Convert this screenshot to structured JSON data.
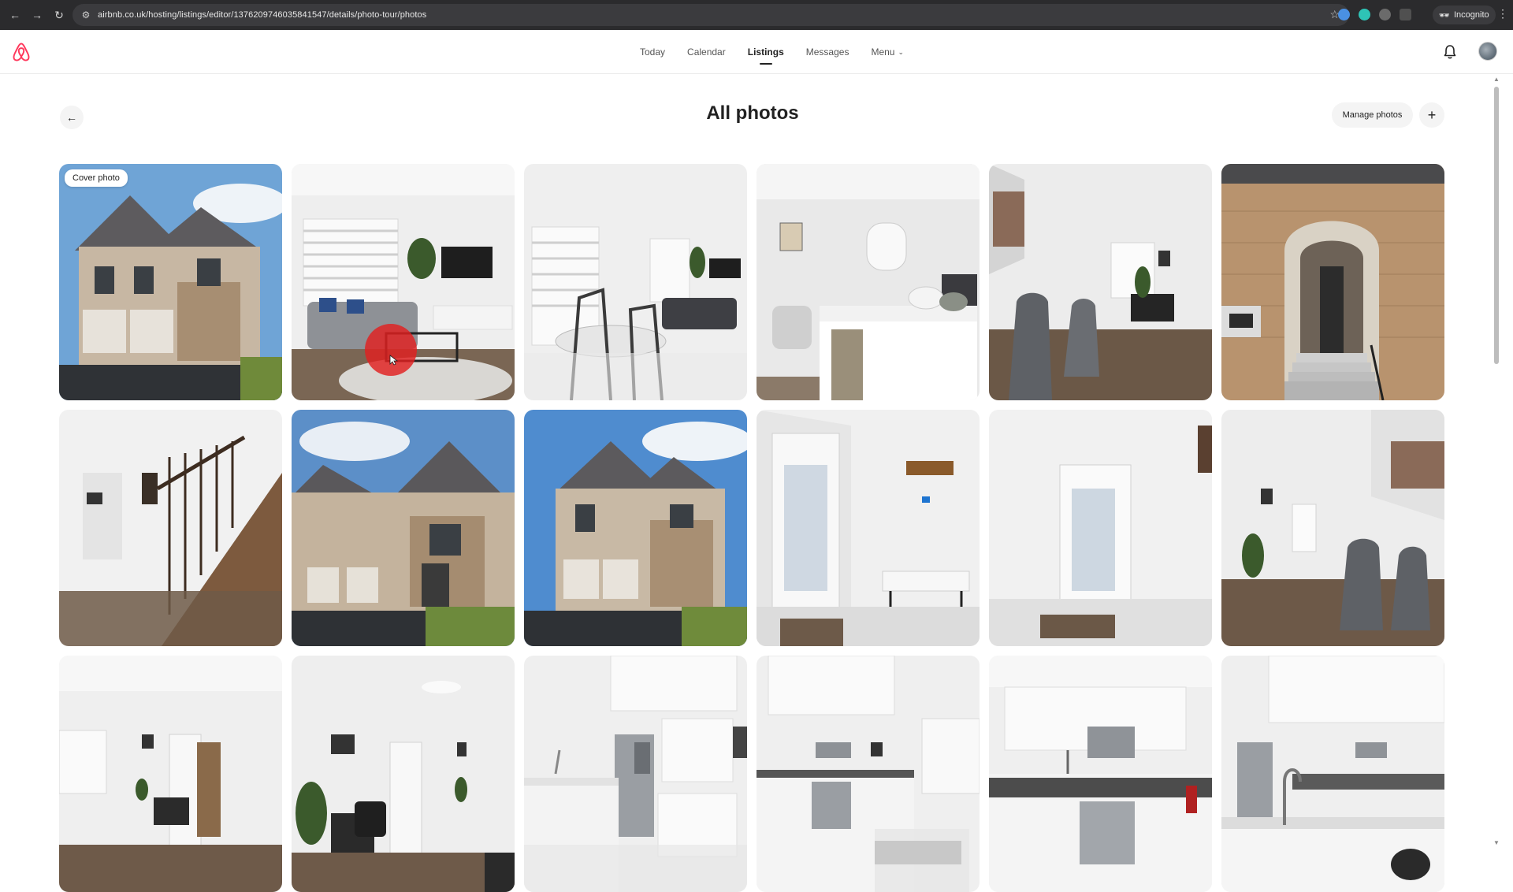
{
  "browser": {
    "url": "airbnb.co.uk/hosting/listings/editor/1376209746035841547/details/photo-tour/photos",
    "incognito_label": "Incognito",
    "icons": [
      "back-arrow-icon",
      "forward-arrow-icon",
      "reload-icon",
      "site-info-icon",
      "bookmark-star-icon",
      "extensions-icon",
      "kebab-menu-icon"
    ]
  },
  "header": {
    "nav": [
      {
        "label": "Today"
      },
      {
        "label": "Calendar"
      },
      {
        "label": "Listings"
      },
      {
        "label": "Messages"
      },
      {
        "label": "Menu"
      }
    ],
    "active_tab": "Listings"
  },
  "page": {
    "title": "All photos",
    "manage_label": "Manage photos",
    "add_symbol": "+",
    "back_symbol": "←"
  },
  "photos": {
    "cover_label": "Cover photo",
    "count_visible": 18,
    "scenes": [
      "house-exterior-front",
      "living-room",
      "dining-and-living",
      "bedroom",
      "sitting-area",
      "front-entrance",
      "staircase-hallway",
      "house-exterior-angle",
      "house-exterior-front",
      "entry-door-bench",
      "entry-door",
      "living-corner-chairs",
      "hallway-desk",
      "room-with-desk",
      "kitchen-fridge",
      "kitchen-stove",
      "kitchen-microwave",
      "kitchen-island"
    ]
  },
  "colors": {
    "brand": "#FF385C",
    "chrome": "#2b2b2d",
    "text": "#222222"
  }
}
